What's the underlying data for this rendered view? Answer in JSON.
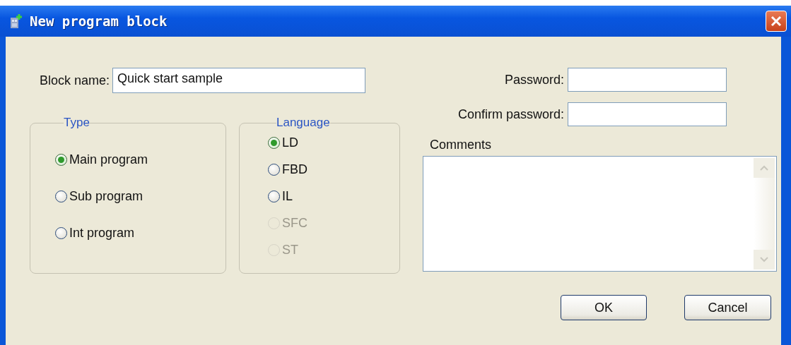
{
  "window": {
    "title": "New program block"
  },
  "block_name": {
    "label": "Block name:",
    "value": "Quick start sample"
  },
  "type_group": {
    "title": "Type",
    "options": [
      {
        "label": "Main program",
        "selected": true,
        "disabled": false
      },
      {
        "label": "Sub program",
        "selected": false,
        "disabled": false
      },
      {
        "label": "Int program",
        "selected": false,
        "disabled": false
      }
    ]
  },
  "language_group": {
    "title": "Language",
    "options": [
      {
        "label": "LD",
        "selected": true,
        "disabled": false
      },
      {
        "label": "FBD",
        "selected": false,
        "disabled": false
      },
      {
        "label": "IL",
        "selected": false,
        "disabled": false
      },
      {
        "label": "SFC",
        "selected": false,
        "disabled": true
      },
      {
        "label": "ST",
        "selected": false,
        "disabled": true
      }
    ]
  },
  "password": {
    "label": "Password:"
  },
  "confirm_password": {
    "label": "Confirm password:"
  },
  "comments": {
    "label": "Comments"
  },
  "buttons": [
    {
      "label": "OK"
    },
    {
      "label": "Cancel"
    }
  ]
}
